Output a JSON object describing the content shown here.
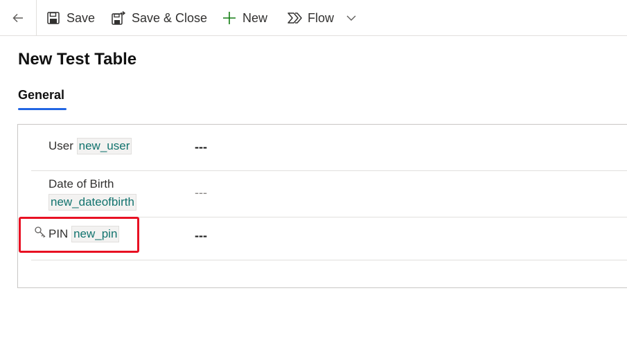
{
  "toolbar": {
    "back_icon": "arrow-left-icon",
    "save_label": "Save",
    "save_close_label": "Save & Close",
    "new_label": "New",
    "flow_label": "Flow",
    "accent_new": "#107c10"
  },
  "header": {
    "title": "New Test Table",
    "tabs": [
      {
        "label": "General",
        "selected": true
      }
    ],
    "tab_accent": "#2266e3"
  },
  "fields": [
    {
      "label": "User",
      "schema": "new_user",
      "value": "---"
    },
    {
      "label": "Date of Birth",
      "schema": "new_dateofbirth",
      "value": "---"
    },
    {
      "label": "PIN",
      "schema": "new_pin",
      "value": "---",
      "icon": "key-icon"
    }
  ],
  "highlight_color": "#e81123"
}
